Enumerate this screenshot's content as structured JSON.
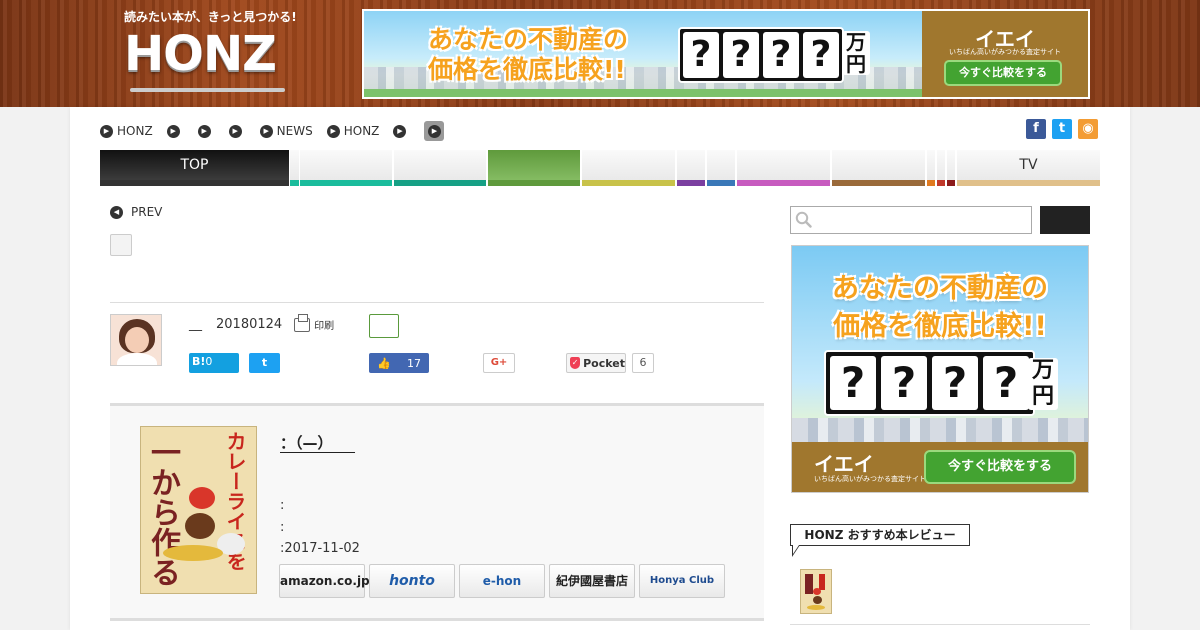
{
  "header": {
    "tagline": "読みたい本が、きっと見つかる!",
    "logo": "HONZ"
  },
  "ad": {
    "line1": "あなたの不動産の",
    "line2": "価格を徹底比較!!",
    "boxes": [
      "?",
      "?",
      "?",
      "?"
    ],
    "unit": "万円",
    "brand": "イエイ",
    "brand_sub": "いちばん高いがみつかる査定サイト",
    "cta": "今すぐ比較をする"
  },
  "breadcrumbs": [
    "HONZ",
    "",
    "",
    "",
    "NEWS",
    "HONZ",
    "",
    ""
  ],
  "nav": {
    "items": [
      {
        "label": "TOP",
        "bar": "#333333"
      },
      {
        "label": "",
        "bar": "#1abc9c"
      },
      {
        "label": "",
        "bar": "#1abc9c"
      },
      {
        "label": "",
        "bar": "#16a085"
      },
      {
        "label": "",
        "bar": "#5f9a3c"
      },
      {
        "label": "",
        "bar": "#c8c24a"
      },
      {
        "label": "",
        "bar": "#7b3fa0"
      },
      {
        "label": "",
        "bar": "#3a78b8"
      },
      {
        "label": "",
        "bar": "#c75bbf"
      },
      {
        "label": "",
        "bar": "#9a6a3a"
      },
      {
        "label": "",
        "bar": "#e07a20"
      },
      {
        "label": "",
        "bar": "#c0392b"
      },
      {
        "label": "",
        "bar": "#8b1a1a"
      },
      {
        "label": "TV",
        "bar": "#e0c08a"
      }
    ]
  },
  "article": {
    "prev": "PREV",
    "author_dash": "__",
    "date": "20180124",
    "print": "印刷",
    "share": {
      "hatena": "B!",
      "hatena_count": "0",
      "fb_count": "17",
      "gplus": "G+",
      "pocket": "Pocket",
      "pocket_count": "6"
    }
  },
  "book": {
    "cover_title1": "一から作る",
    "cover_title2": "カレーライスを",
    "title": "：（—）　　",
    "info1": ":",
    "info2": ":",
    "info3": ":2017-11-02",
    "shops": [
      "amazon.co.jp",
      "honto",
      "e-hon",
      "紀伊國屋書店",
      "Honya Club"
    ]
  },
  "sidebar": {
    "search_placeholder": "",
    "recommend_heading": "HONZ おすすめ本レビュー"
  }
}
